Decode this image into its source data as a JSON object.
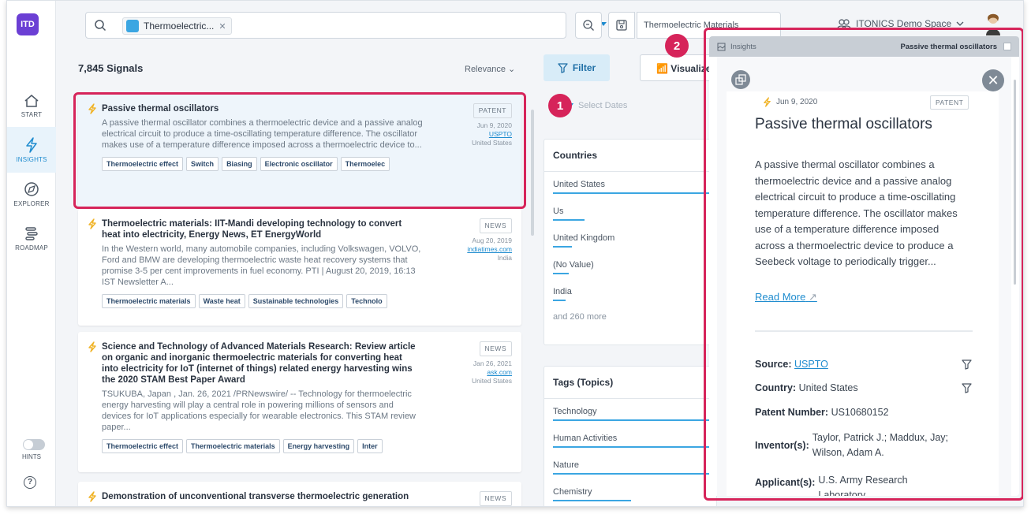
{
  "nav": {
    "logo": "ITD",
    "items": [
      {
        "label": "START"
      },
      {
        "label": "INSIGHTS"
      },
      {
        "label": "EXPLORER"
      },
      {
        "label": "ROADMAP"
      }
    ],
    "hints": "HINTS",
    "help": "?"
  },
  "topbar": {
    "chip_label": "Thermoelectric...",
    "saved_search": "Thermoelectric Materials",
    "space": "ITONICS Demo Space"
  },
  "results": {
    "count": "7,845 Signals",
    "sort": "Relevance",
    "cards": [
      {
        "title": "Passive thermal oscillators",
        "body": "A passive thermal oscillator combines a thermoelectric device and a passive analog electrical circuit to produce a time-oscillating temperature difference. The oscillator makes use of a temperature difference imposed across a thermoelectric device to...",
        "badge": "PATENT",
        "date": "Jun 9, 2020",
        "source": "USPTO",
        "country": "United States",
        "tags": [
          "Thermoelectric effect",
          "Switch",
          "Biasing",
          "Electronic oscillator",
          "Thermoelec"
        ]
      },
      {
        "title": "Thermoelectric materials: IIT-Mandi developing technology to convert heat into electricity, Energy News, ET EnergyWorld",
        "body": "In the Western world, many automobile companies, including Volkswagen, VOLVO, Ford and BMW are developing thermoelectric waste heat recovery systems that promise 3-5 per cent improvements in fuel economy. PTI | August 20, 2019, 16:13 IST Newsletter A...",
        "badge": "NEWS",
        "date": "Aug 20, 2019",
        "source": "indiatimes.com",
        "country": "India",
        "tags": [
          "Thermoelectric materials",
          "Waste heat",
          "Sustainable technologies",
          "Technolo"
        ]
      },
      {
        "title": "Science and Technology of Advanced Materials Research: Review article on organic and inorganic thermoelectric materials for converting heat into electricity for IoT (internet of things) related energy harvesting wins the 2020 STAM Best Paper Award",
        "body": "TSUKUBA, Japan , Jan. 26, 2021 /PRNewswire/ -- Technology for thermoelectric energy harvesting will play a central role in powering millions of sensors and devices for IoT applications especially for wearable electronics. This STAM review paper...",
        "badge": "NEWS",
        "date": "Jan 26, 2021",
        "source": "ask.com",
        "country": "United States",
        "tags": [
          "Thermoelectric effect",
          "Thermoelectric materials",
          "Energy harvesting",
          "Inter"
        ]
      },
      {
        "title": "Demonstration of unconventional transverse thermoelectric generation",
        "badge": "NEWS"
      }
    ]
  },
  "filters": {
    "filter_label": "Filter",
    "visualize_label": "Visualize",
    "dates_placeholder": "Select Dates",
    "countries": {
      "header": "Countries",
      "items": [
        {
          "label": "United States",
          "share": 1.0
        },
        {
          "label": "Us",
          "share": 0.2
        },
        {
          "label": "United Kingdom",
          "share": 0.12
        },
        {
          "label": "(No Value)",
          "share": 0.1
        },
        {
          "label": "India",
          "share": 0.08
        }
      ],
      "more": "and 260 more"
    },
    "tags": {
      "header": "Tags (Topics)",
      "items": [
        {
          "label": "Technology",
          "share": 1.0
        },
        {
          "label": "Human Activities",
          "share": 1.0
        },
        {
          "label": "Nature",
          "share": 1.0
        },
        {
          "label": "Chemistry",
          "share": 0.5
        }
      ]
    }
  },
  "callouts": [
    "1",
    "2"
  ],
  "insight": {
    "header_left": "Insights",
    "header_right": "Passive thermal oscillators",
    "date": "Jun 9, 2020",
    "badge": "PATENT",
    "title": "Passive thermal oscillators",
    "text": "A passive thermal oscillator combines a thermoelectric device and a passive analog electrical circuit to produce a time-oscillating temperature difference. The oscillator makes use of a temperature difference imposed across a thermoelectric device to produce a Seebeck voltage to periodically trigger...",
    "read_more": "Read More",
    "source_label": "Source:",
    "source_value": "USPTO",
    "country_label": "Country:",
    "country_value": "United States",
    "patent_label": "Patent Number:",
    "patent_value": "US10680152",
    "inventor_label": "Inventor(s):",
    "inventor_value": "Taylor, Patrick J.; Maddux, Jay; Wilson, Adam A.",
    "applicant_label": "Applicant(s):",
    "applicant_value": "U.S. Army Research Laboratory"
  },
  "colors": {
    "accent": "#1f8ccf",
    "callout": "#d6245a",
    "brand": "#6b3fd4"
  }
}
